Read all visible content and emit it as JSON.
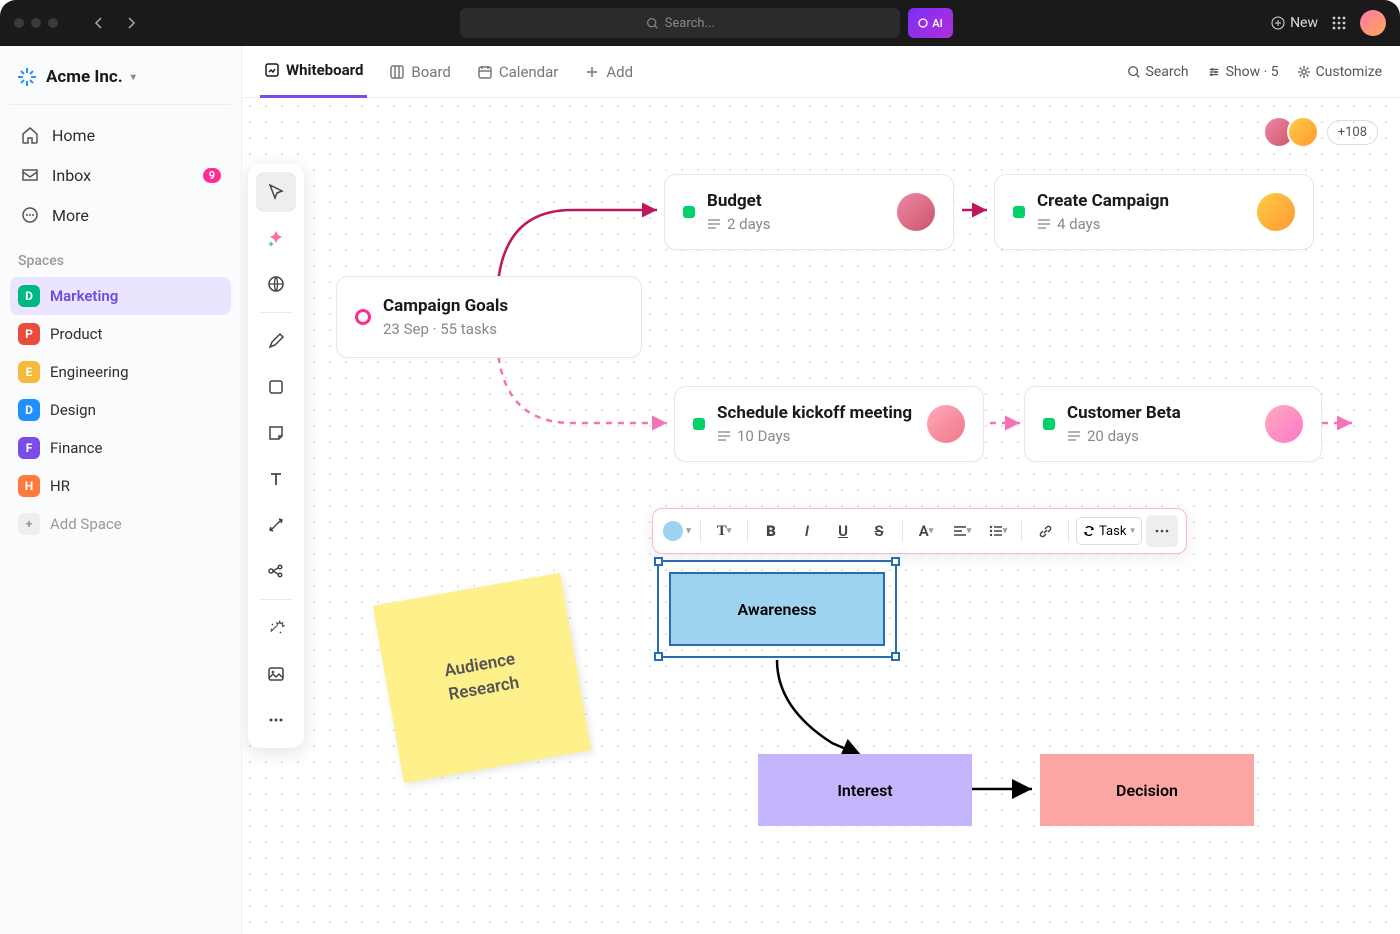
{
  "topbar": {
    "search_placeholder": "Search...",
    "ai_label": "AI",
    "new_label": "New"
  },
  "org": {
    "name": "Acme Inc."
  },
  "nav": {
    "home": "Home",
    "inbox": "Inbox",
    "inbox_badge": "9",
    "more": "More"
  },
  "spaces_label": "Spaces",
  "spaces": [
    {
      "letter": "D",
      "label": "Marketing",
      "cls": "d",
      "active": true
    },
    {
      "letter": "P",
      "label": "Product",
      "cls": "p"
    },
    {
      "letter": "E",
      "label": "Engineering",
      "cls": "e"
    },
    {
      "letter": "D",
      "label": "Design",
      "cls": "dd"
    },
    {
      "letter": "F",
      "label": "Finance",
      "cls": "f"
    },
    {
      "letter": "H",
      "label": "HR",
      "cls": "h"
    }
  ],
  "add_space": "Add Space",
  "viewtabs": {
    "whiteboard": "Whiteboard",
    "board": "Board",
    "calendar": "Calendar",
    "add": "Add"
  },
  "viewright": {
    "search": "Search",
    "show": "Show · 5",
    "customize": "Customize"
  },
  "avatars_more": "+108",
  "cards": {
    "goals": {
      "title": "Campaign Goals",
      "sub": "23 Sep  ·  55 tasks"
    },
    "budget": {
      "title": "Budget",
      "sub": "2 days"
    },
    "create": {
      "title": "Create Campaign",
      "sub": "4 days"
    },
    "kickoff": {
      "title": "Schedule kickoff meeting",
      "sub": "10 Days"
    },
    "beta": {
      "title": "Customer Beta",
      "sub": "20 days"
    }
  },
  "sticky": "Audience\nResearch",
  "fmt_task": "Task",
  "flow": {
    "awareness": "Awareness",
    "interest": "Interest",
    "decision": "Decision"
  }
}
